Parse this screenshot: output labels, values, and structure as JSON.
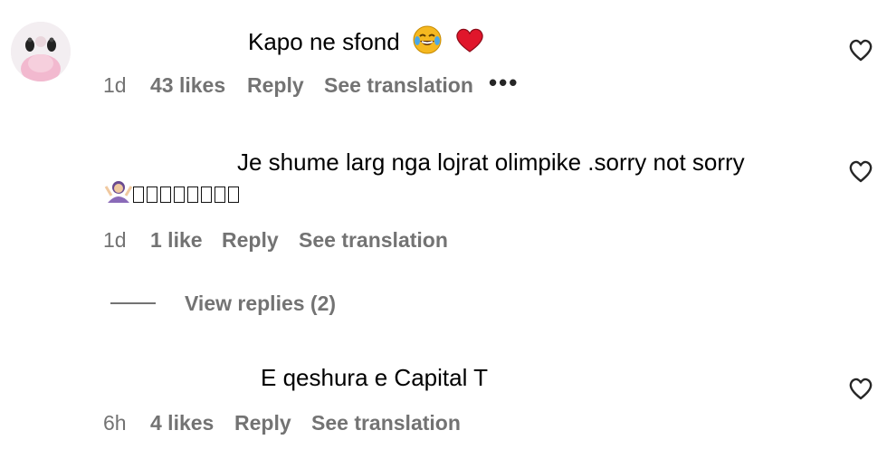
{
  "comments": [
    {
      "text": "Kapo ne sfond",
      "emojis": [
        "joy-face-emoji",
        "red-heart-emoji"
      ],
      "time": "1d",
      "likes": "43 likes",
      "reply": "Reply",
      "translation": "See translation",
      "more": "•••"
    },
    {
      "text": "Je shume larg nga lojrat olimpike .sorry not sorry",
      "emojis": [
        "shrug-person-emoji"
      ],
      "tofu_count": 8,
      "time": "1d",
      "likes": "1 like",
      "reply": "Reply",
      "translation": "See translation"
    },
    {
      "text": "E qeshura e Capital T",
      "time": "6h",
      "likes": "4 likes",
      "reply": "Reply",
      "translation": "See translation"
    }
  ],
  "replies": {
    "label": "View replies (2)"
  },
  "colors": {
    "text": "#000000",
    "meta": "#737373",
    "heart": "#262626",
    "emoji_heart": "#e0162b",
    "emoji_face": "#f5b820"
  }
}
